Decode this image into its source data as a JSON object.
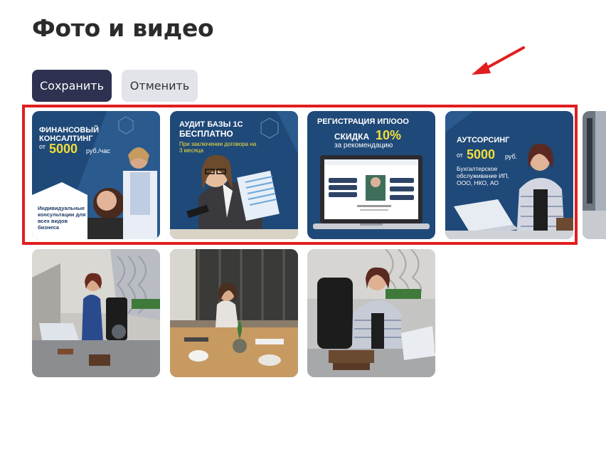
{
  "page": {
    "title": "Фото и видео"
  },
  "actions": {
    "save_label": "Сохранить",
    "cancel_label": "Отменить"
  },
  "colors": {
    "save_bg": "#2e3150",
    "cancel_bg": "#e3e4ea",
    "highlight": "#e01e1e",
    "promo_bg": "#1f4978",
    "accent_yellow": "#f3de3a"
  },
  "promo_tiles": [
    {
      "heading": "ФИНАНСОВЫЙ КОНСАЛТИНГ",
      "price_prefix": "от",
      "price": "5000",
      "price_suffix": "руб./час",
      "caption": "Индивидуальные консультации для всех видов бизнеса"
    },
    {
      "heading1": "АУДИТ БАЗЫ 1С",
      "heading2": "БЕСПЛАТНО",
      "subtext": "При заключении договора на 3 месяца"
    },
    {
      "heading": "РЕГИСТРАЦИЯ ИП/ООО",
      "discount_prefix": "СКИДКА",
      "discount": "10%",
      "subtext": "за рекомендацию"
    },
    {
      "heading": "АУТСОРСИНГ",
      "price_prefix": "от",
      "price": "5000",
      "price_suffix": "руб.",
      "caption": "Бухгалтерское обслуживание ИП, ООО, НКО, АО"
    }
  ]
}
